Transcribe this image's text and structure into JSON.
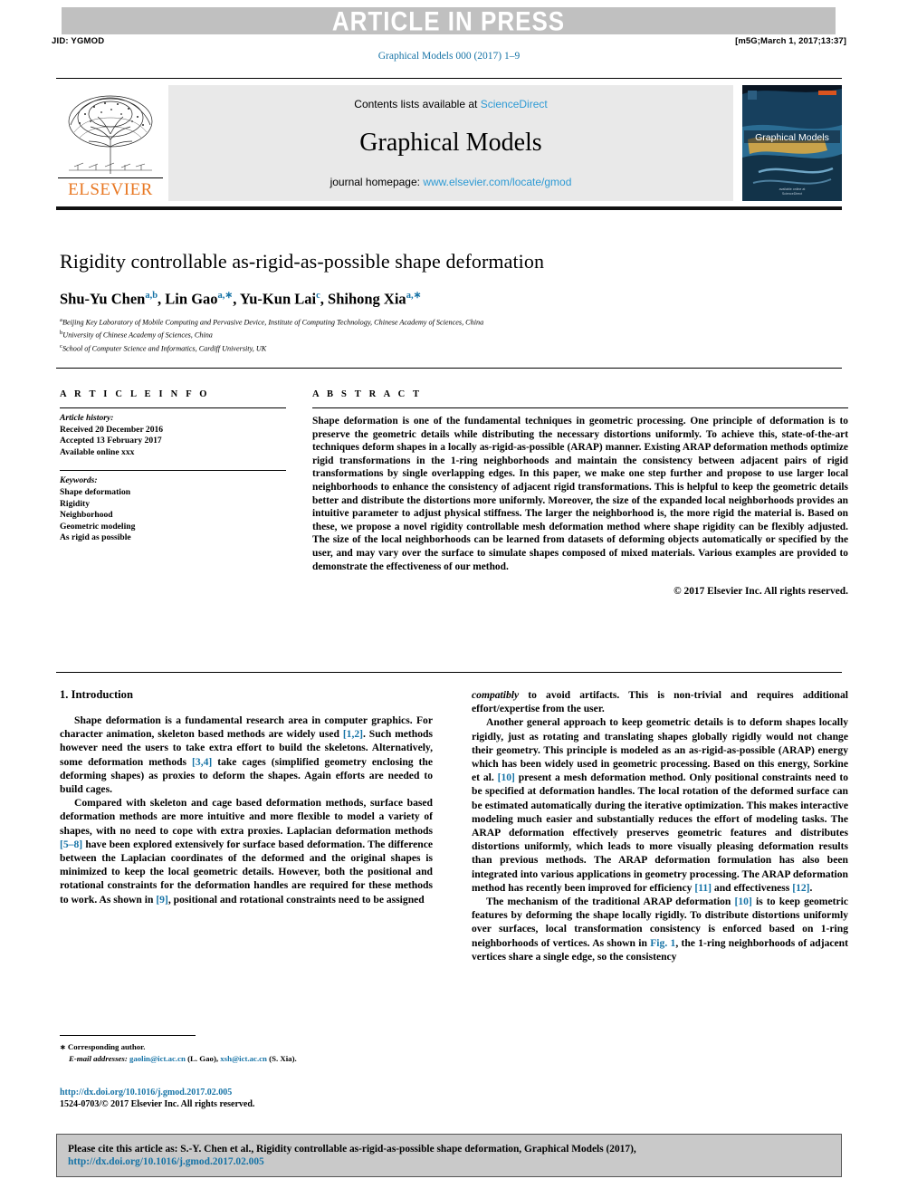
{
  "banner": {
    "text": "ARTICLE IN PRESS",
    "jid": "JID: YGMOD",
    "stamp": "[m5G;March 1, 2017;13:37]",
    "band_color": "#c0c0c0"
  },
  "journal_line": "Graphical Models 000 (2017) 1–9",
  "masthead": {
    "contents_prefix": "Contents lists available at ",
    "contents_link": "ScienceDirect",
    "journal_title": "Graphical Models",
    "homepage_prefix": "journal homepage: ",
    "homepage_link": "www.elsevier.com/locate/gmod",
    "publisher": "ELSEVIER",
    "publisher_color": "#e87722",
    "link_color": "#2d9ad4",
    "cover_title": "Graphical Models"
  },
  "article": {
    "title": "Rigidity controllable as-rigid-as-possible shape deformation",
    "authors_html": "Shu-Yu Chen<sup>a,b</sup>, Lin Gao<sup>a,∗</sup>, Yu-Kun Lai<sup>c</sup>, Shihong Xia<sup>a,∗</sup>",
    "affiliations": [
      {
        "marker": "a",
        "text": "Beijing Key Laboratory of Mobile Computing and Pervasive Device, Institute of Computing Technology, Chinese Academy of Sciences, China"
      },
      {
        "marker": "b",
        "text": "University of Chinese Academy of Sciences, China"
      },
      {
        "marker": "c",
        "text": "School of Computer Science and Informatics, Cardiff University, UK"
      }
    ]
  },
  "article_info": {
    "label": "A R T I C L E    I N F O",
    "history_heading": "Article history:",
    "history": [
      "Received 20 December 2016",
      "Accepted 13 February 2017",
      "Available online xxx"
    ],
    "keywords_heading": "Keywords:",
    "keywords": [
      "Shape deformation",
      "Rigidity",
      "Neighborhood",
      "Geometric modeling",
      "As rigid as possible"
    ]
  },
  "abstract": {
    "label": "A B S T R A C T",
    "text": "Shape deformation is one of the fundamental techniques in geometric processing. One principle of deformation is to preserve the geometric details while distributing the necessary distortions uniformly. To achieve this, state-of-the-art techniques deform shapes in a locally as-rigid-as-possible (ARAP) manner. Existing ARAP deformation methods optimize rigid transformations in the 1-ring neighborhoods and maintain the consistency between adjacent pairs of rigid transformations by single overlapping edges. In this paper, we make one step further and propose to use larger local neighborhoods to enhance the consistency of adjacent rigid transformations. This is helpful to keep the geometric details better and distribute the distortions more uniformly. Moreover, the size of the expanded local neighborhoods provides an intuitive parameter to adjust physical stiffness. The larger the neighborhood is, the more rigid the material is. Based on these, we propose a novel rigidity controllable mesh deformation method where shape rigidity can be flexibly adjusted. The size of the local neighborhoods can be learned from datasets of deforming objects automatically or specified by the user, and may vary over the surface to simulate shapes composed of mixed materials. Various examples are provided to demonstrate the effectiveness of our method.",
    "copyright": "© 2017 Elsevier Inc. All rights reserved."
  },
  "body": {
    "section_heading": "1. Introduction",
    "left_paragraphs": [
      "Shape deformation is a fundamental research area in computer graphics. For character animation, skeleton based methods are widely used <span class=\"ref\">[1,2]</span>. Such methods however need the users to take extra effort to build the skeletons. Alternatively, some deformation methods <span class=\"ref\">[3,4]</span> take cages (simplified geometry enclosing the deforming shapes) as proxies to deform the shapes. Again efforts are needed to build cages.",
      "Compared with skeleton and cage based deformation methods, surface based deformation methods are more intuitive and more flexible to model a variety of shapes, with no need to cope with extra proxies. Laplacian deformation methods <span class=\"ref\">[5&ndash;8]</span> have been explored extensively for surface based deformation. The difference between the Laplacian coordinates of the deformed and the original shapes is minimized to keep the local geometric details. However, both the positional and rotational constraints for the deformation handles are required for these methods to work. As shown in <span class=\"ref\">[9]</span>, positional and rotational constraints need to be assigned"
    ],
    "right_paragraphs": [
      "<span class=\"it\">compatibly</span> to avoid artifacts. This is non-trivial and requires additional effort/expertise from the user.",
      "Another general approach to keep geometric details is to deform shapes locally rigidly, just as rotating and translating shapes globally rigidly would not change their geometry. This principle is modeled as an as-rigid-as-possible (ARAP) energy which has been widely used in geometric processing. Based on this energy, Sorkine et al. <span class=\"ref\">[10]</span> present a mesh deformation method. Only positional constraints need to be specified at deformation handles. The local rotation of the deformed surface can be estimated automatically during the iterative optimization. This makes interactive modeling much easier and substantially reduces the effort of modeling tasks. The ARAP deformation effectively preserves geometric features and distributes distortions uniformly, which leads to more visually pleasing deformation results than previous methods. The ARAP deformation formulation has also been integrated into various applications in geometry processing. The ARAP deformation method has recently been improved for efficiency <span class=\"ref\">[11]</span> and effectiveness <span class=\"ref\">[12]</span>.",
      "The mechanism of the traditional ARAP deformation <span class=\"ref\">[10]</span> is to keep geometric features by deforming the shape locally rigidly. To distribute distortions uniformly over surfaces, local transformation consistency is enforced based on 1-ring neighborhoods of vertices. As shown in <span class=\"ref\">Fig. 1</span>, the 1-ring neighborhoods of adjacent vertices share a single edge, so the consistency"
    ]
  },
  "footnote": {
    "corresponding": "Corresponding author.",
    "email_label": "E-mail addresses:",
    "emails_html": "<span class=\"mail\">gaolin@ict.ac.cn</span> (L. Gao), <span class=\"mail\">xsh@ict.ac.cn</span> (S. Xia).",
    "doi": "http://dx.doi.org/10.1016/j.gmod.2017.02.005",
    "issn_line": "1524-0703/© 2017 Elsevier Inc. All rights reserved."
  },
  "citation_footer": {
    "text": "Please cite this article as: S.-Y. Chen et al., Rigidity controllable as-rigid-as-possible shape deformation, Graphical Models (2017),",
    "link": "http://dx.doi.org/10.1016/j.gmod.2017.02.005",
    "bg_color": "#c9c9c9",
    "link_color": "#1673a6"
  }
}
